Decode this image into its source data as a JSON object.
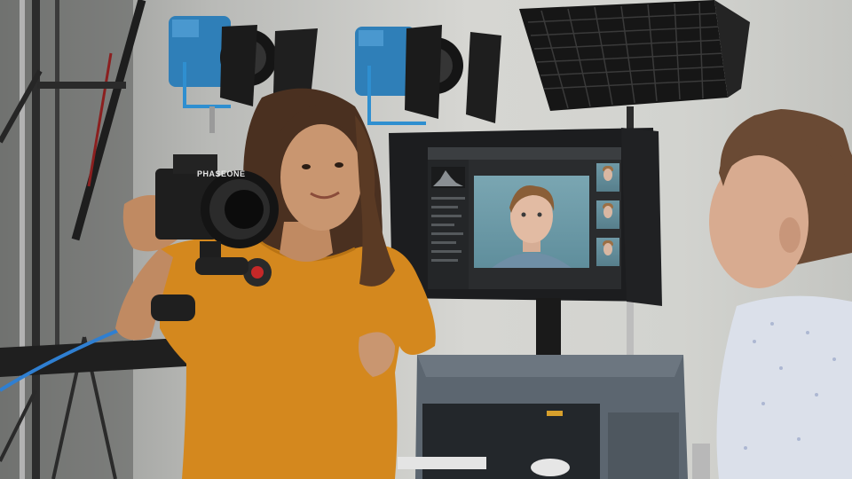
{
  "scene": {
    "camera_brand_text": "PHASEONE"
  },
  "colors": {
    "wall": "#cfd0cd",
    "shirt_orange": "#d4881e",
    "light_blue": "#2f7fb8",
    "monitor_black": "#1c1d1f",
    "cart_gray": "#5c6670"
  },
  "icons": [
    "camera-icon",
    "studio-light-icon",
    "softbox-icon",
    "monitor-icon"
  ]
}
